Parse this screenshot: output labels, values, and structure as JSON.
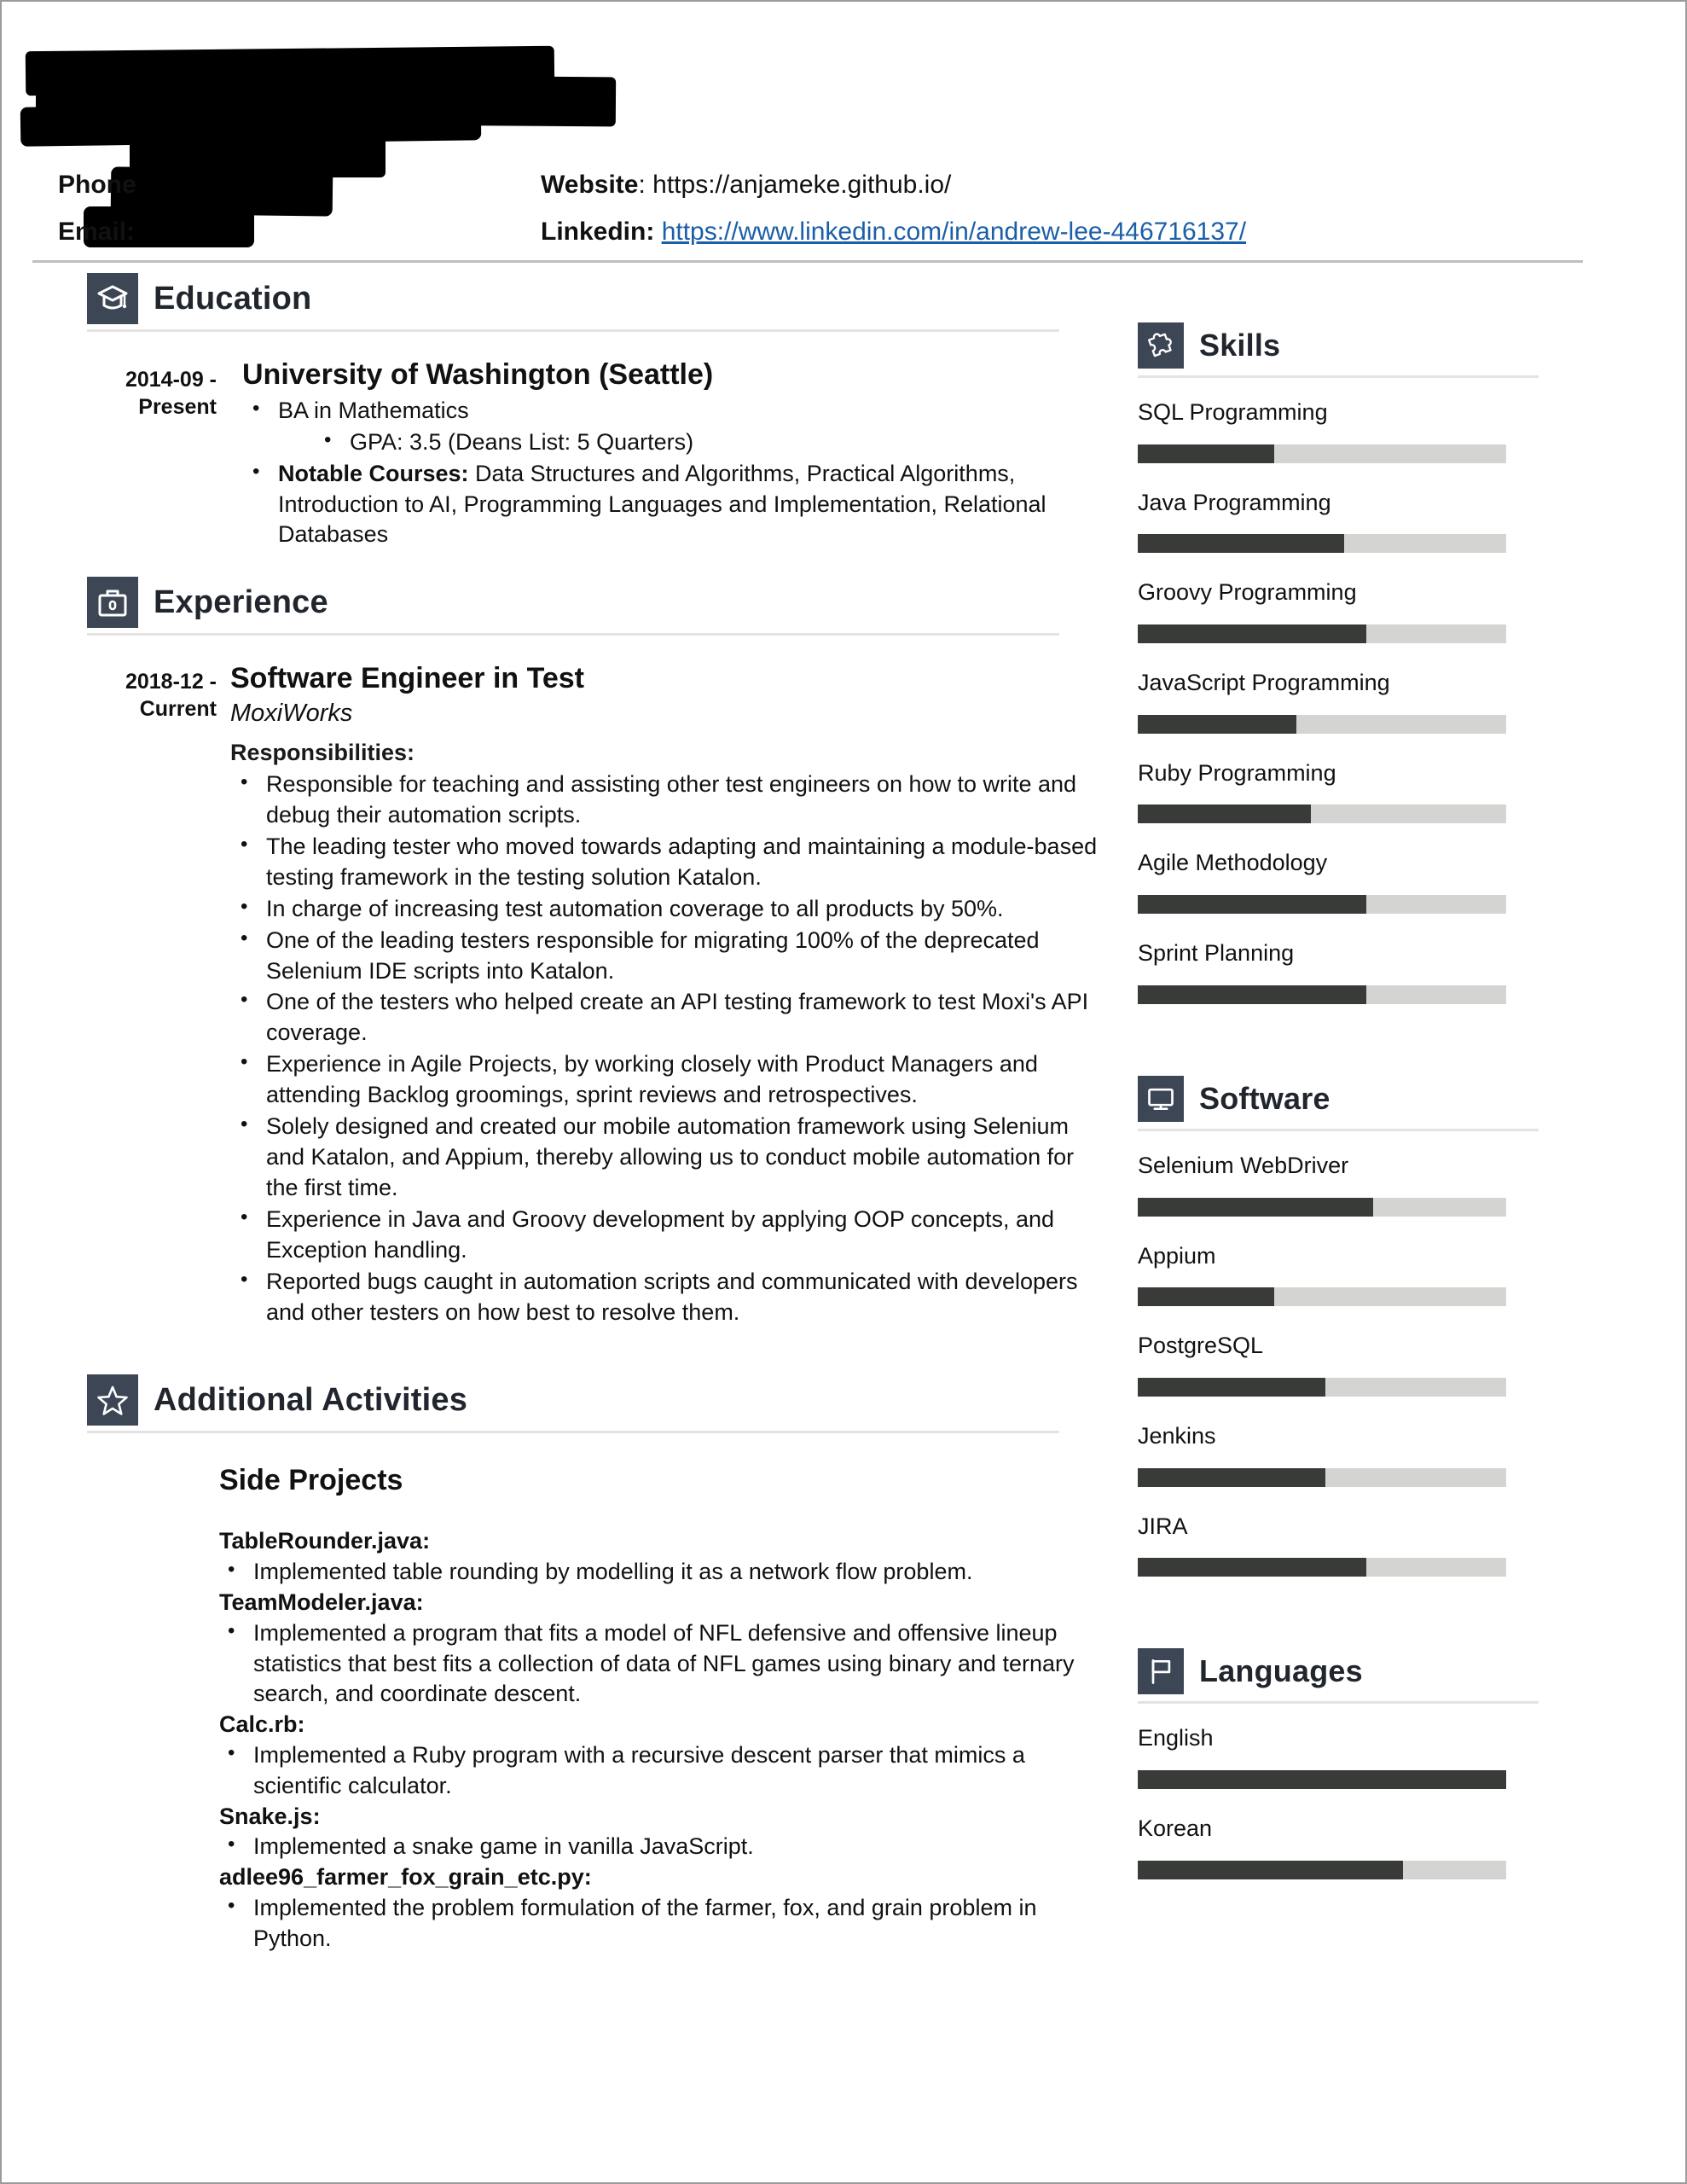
{
  "header": {
    "name_redacted": true,
    "phone_label": "Phone",
    "phone_value": "",
    "email_label": "Email:",
    "email_value": "",
    "website_label": "Website",
    "website_separator": ": ",
    "website_value": "https://anjameke.github.io/",
    "linkedin_label": "Linkedin:",
    "linkedin_value": "https://www.linkedin.com/in/andrew-lee-446716137/",
    "link_color": "#1b5fa8"
  },
  "theme": {
    "icon_box_color": "#3c4655",
    "meter_fill_color": "#393b38",
    "meter_track_color": "#d4d4d2",
    "rule_color": "#e3e3e3",
    "header_rule_color": "#bfbfbf"
  },
  "sections": {
    "education": {
      "title": "Education",
      "icon": "graduation-cap-icon",
      "entries": [
        {
          "date": "2014-09 - Present",
          "date_line1": "2014-09 -",
          "date_line2": "Present",
          "title": "University of Washington (Seattle)",
          "bullets": [
            {
              "level": 1,
              "text": "BA in Mathematics"
            },
            {
              "level": 2,
              "text": "GPA: 3.5 (Deans List: 5 Quarters)"
            },
            {
              "level": 1,
              "bold_prefix": "Notable Courses:",
              "text": " Data Structures and Algorithms, Practical Algorithms, Introduction to AI, Programming Languages and Implementation, Relational Databases"
            }
          ]
        }
      ]
    },
    "experience": {
      "title": "Experience",
      "icon": "briefcase-icon",
      "entries": [
        {
          "date_line1": "2018-12 -",
          "date_line2": "Current",
          "title": "Software Engineer in Test",
          "company": "MoxiWorks",
          "responsibilities_label": "Responsibilities:",
          "bullets": [
            "Responsible for teaching and assisting other test engineers on how to write and debug their automation scripts.",
            "The leading tester who moved towards adapting and maintaining a module-based testing framework in the testing solution Katalon.",
            "In charge of increasing test automation coverage to all products by 50%.",
            "One of the leading testers responsible for migrating 100% of the deprecated Selenium IDE scripts into Katalon.",
            "One of the testers who helped create an API testing framework to test Moxi's API coverage.",
            "Experience in Agile Projects, by working closely with Product Managers and attending Backlog groomings, sprint reviews and retrospectives.",
            "Solely designed and created our mobile automation framework using Selenium and Katalon, and Appium, thereby allowing us to conduct mobile automation for the first time.",
            "Experience in Java and Groovy development by applying OOP concepts, and Exception handling.",
            "Reported bugs caught in automation scripts and communicated with developers and other testers on how best to resolve them."
          ]
        }
      ]
    },
    "additional_activities": {
      "title": "Additional Activities",
      "icon": "star-icon",
      "subtitle": "Side Projects",
      "projects": [
        {
          "name": "TableRounder.java:",
          "description": "Implemented table rounding by modelling it as a network flow problem."
        },
        {
          "name": "TeamModeler.java:",
          "description": "Implemented a program that fits a model of NFL defensive and offensive lineup statistics that best fits a collection of data of NFL games using binary and ternary search, and coordinate descent."
        },
        {
          "name": "Calc.rb:",
          "description": "Implemented a Ruby program with a recursive descent parser that mimics a scientific calculator."
        },
        {
          "name": "Snake.js:",
          "description": "Implemented a snake game in vanilla JavaScript."
        },
        {
          "name": "adlee96_farmer_fox_grain_etc.py:",
          "description": "Implemented the problem formulation of the farmer, fox, and grain problem in Python."
        }
      ]
    },
    "skills": {
      "title": "Skills",
      "icon": "puzzle-piece-icon",
      "items": [
        {
          "label": "SQL Programming",
          "percent": 37
        },
        {
          "label": "Java Programming",
          "percent": 56
        },
        {
          "label": "Groovy Programming",
          "percent": 62
        },
        {
          "label": "JavaScript Programming",
          "percent": 43
        },
        {
          "label": "Ruby Programming",
          "percent": 47
        },
        {
          "label": "Agile Methodology",
          "percent": 62
        },
        {
          "label": "Sprint Planning",
          "percent": 62
        }
      ]
    },
    "software": {
      "title": "Software",
      "icon": "monitor-icon",
      "items": [
        {
          "label": "Selenium WebDriver",
          "percent": 64
        },
        {
          "label": "Appium",
          "percent": 37
        },
        {
          "label": "PostgreSQL",
          "percent": 51
        },
        {
          "label": "Jenkins",
          "percent": 51
        },
        {
          "label": "JIRA",
          "percent": 62
        }
      ]
    },
    "languages": {
      "title": "Languages",
      "icon": "flag-icon",
      "items": [
        {
          "label": "English",
          "percent": 100
        },
        {
          "label": "Korean",
          "percent": 72
        }
      ]
    }
  }
}
